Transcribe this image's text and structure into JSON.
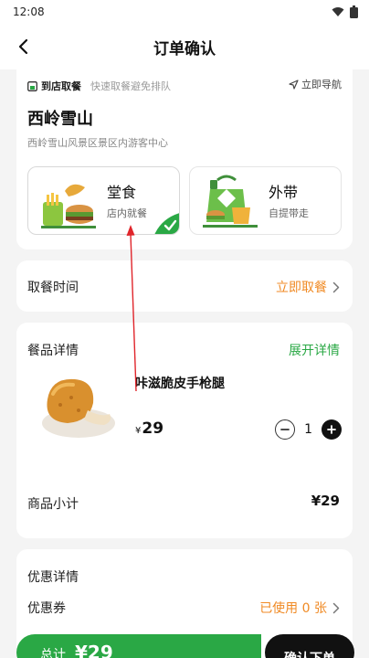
{
  "status_bar": {
    "time": "12:08"
  },
  "header": {
    "title": "订单确认"
  },
  "store": {
    "pickup_label": "到店取餐",
    "pickup_tip": "快速取餐避免排队",
    "nav_label": "立即导航",
    "name": "西岭雪山",
    "address": "西岭雪山风景区景区内游客中心",
    "modes": [
      {
        "title": "堂食",
        "subtitle": "店内就餐",
        "selected": true
      },
      {
        "title": "外带",
        "subtitle": "自提带走",
        "selected": false
      }
    ]
  },
  "pickup_time": {
    "label": "取餐时间",
    "value": "立即取餐"
  },
  "detail": {
    "title": "餐品详情",
    "expand_label": "展开详情",
    "item": {
      "name": "咔滋脆皮手枪腿",
      "currency": "¥",
      "price": "29",
      "quantity": "1"
    },
    "subtotal_label": "商品小计",
    "subtotal_value": "¥29"
  },
  "promo": {
    "title": "优惠详情",
    "coupon_label": "优惠券",
    "coupon_value": "已使用 0 张"
  },
  "footer": {
    "total_label": "总计",
    "total_value": "¥29",
    "submit_label": "确认下单"
  },
  "colors": {
    "accent_green": "#2aa845",
    "accent_orange": "#f08a24",
    "annotation_red": "#e0252b"
  }
}
